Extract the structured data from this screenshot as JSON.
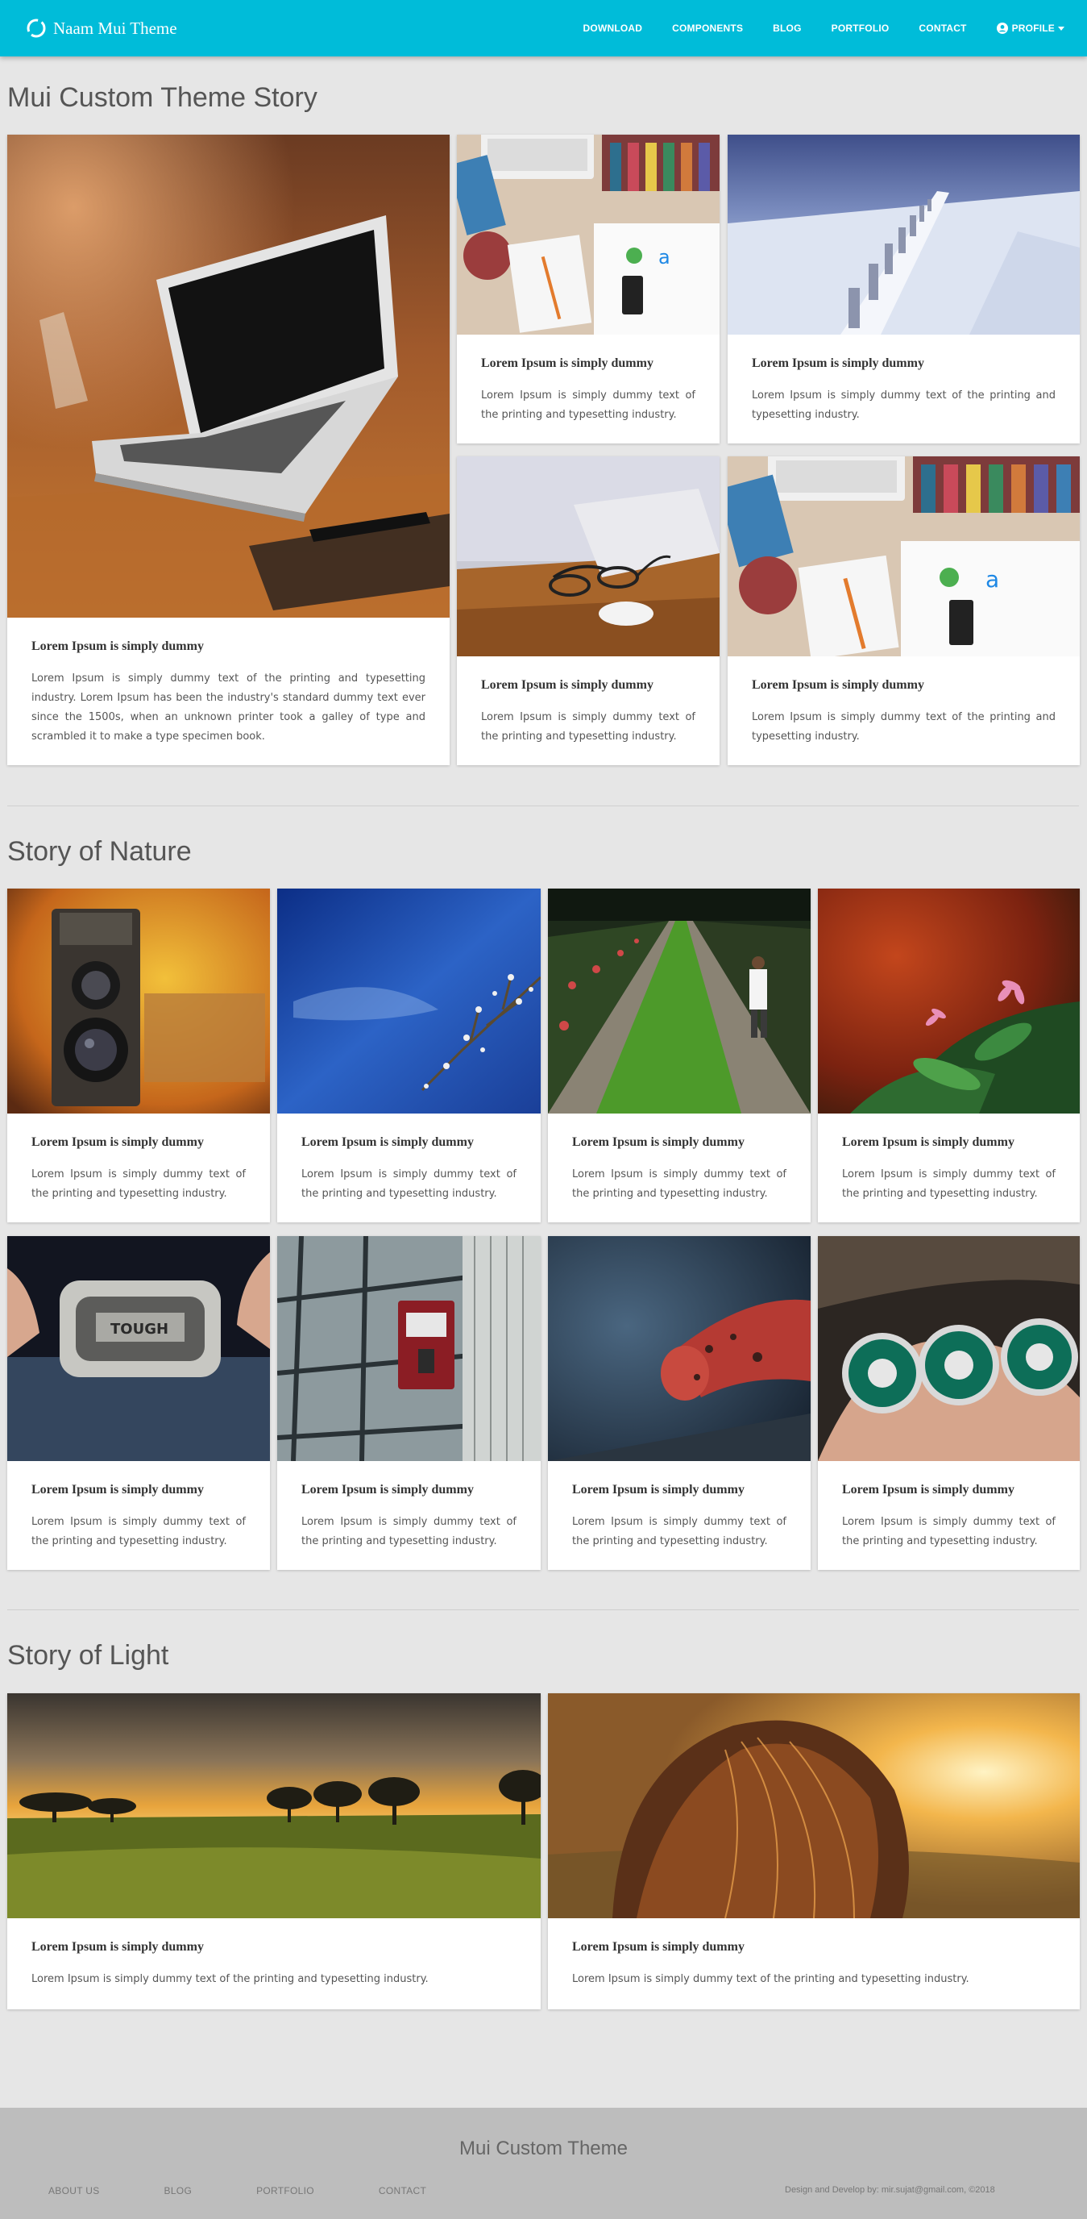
{
  "navbar": {
    "brand": "Naam Mui Theme",
    "items": [
      {
        "label": "DOWNLOAD"
      },
      {
        "label": "COMPONENTS"
      },
      {
        "label": "BLOG"
      },
      {
        "label": "PORTFOLIO"
      },
      {
        "label": "CONTACT"
      },
      {
        "label": "PROFILE",
        "icon": "user-circle-icon",
        "has_dropdown": true
      }
    ]
  },
  "sections": [
    {
      "title": "Mui Custom Theme Story",
      "cards": [
        {
          "image": "laptop-on-wooden-table-photo",
          "title": "Lorem Ipsum is simply dummy",
          "text": "Lorem Ipsum is simply dummy text of the printing and typesetting industry. Lorem Ipsum has been the industry's standard dummy text ever since the 1500s, when an unknown printer took a galley of type and scrambled it to make a type specimen book."
        },
        {
          "image": "desk-flatlay-photo",
          "title": "Lorem Ipsum is simply dummy",
          "text": "Lorem Ipsum is simply dummy text of the printing and typesetting industry."
        },
        {
          "image": "snowy-fence-landscape-photo",
          "title": "Lorem Ipsum is simply dummy",
          "text": "Lorem Ipsum is simply dummy text of the printing and typesetting industry."
        },
        {
          "image": "glasses-and-mouse-photo",
          "title": "Lorem Ipsum is simply dummy",
          "text": "Lorem Ipsum is simply dummy text of the printing and typesetting industry."
        },
        {
          "image": "desk-flatlay-photo",
          "title": "Lorem Ipsum is simply dummy",
          "text": "Lorem Ipsum is simply dummy text of the printing and typesetting industry."
        }
      ]
    },
    {
      "title": "Story of Nature",
      "cards": [
        {
          "image": "vintage-camera-photo",
          "title": "Lorem Ipsum is simply dummy",
          "text": "Lorem Ipsum is simply dummy text of the printing and typesetting industry."
        },
        {
          "image": "blue-sky-branches-photo",
          "title": "Lorem Ipsum is simply dummy",
          "text": "Lorem Ipsum is simply dummy text of the printing and typesetting industry."
        },
        {
          "image": "garden-path-photo",
          "title": "Lorem Ipsum is simply dummy",
          "text": "Lorem Ipsum is simply dummy text of the printing and typesetting industry."
        },
        {
          "image": "pink-flowers-photo",
          "title": "Lorem Ipsum is simply dummy",
          "text": "Lorem Ipsum is simply dummy text of the printing and typesetting industry."
        },
        {
          "image": "belt-buckle-photo",
          "title": "Lorem Ipsum is simply dummy",
          "text": "Lorem Ipsum is simply dummy text of the printing and typesetting industry."
        },
        {
          "image": "fire-alarm-photo",
          "title": "Lorem Ipsum is simply dummy",
          "text": "Lorem Ipsum is simply dummy text of the printing and typesetting industry."
        },
        {
          "image": "rusty-red-pipe-photo",
          "title": "Lorem Ipsum is simply dummy",
          "text": "Lorem Ipsum is simply dummy text of the printing and typesetting industry."
        },
        {
          "image": "coffee-badges-photo",
          "title": "Lorem Ipsum is simply dummy",
          "text": "Lorem Ipsum is simply dummy text of the printing and typesetting industry."
        }
      ]
    },
    {
      "title": "Story of Light",
      "cards": [
        {
          "image": "sunset-field-photo",
          "title": "Lorem Ipsum is simply dummy",
          "text": "Lorem Ipsum is simply dummy text of the printing and typesetting industry."
        },
        {
          "image": "girl-in-sunlight-photo",
          "title": "Lorem Ipsum is simply dummy",
          "text": "Lorem Ipsum is simply dummy text of the printing and typesetting industry."
        }
      ]
    }
  ],
  "footer": {
    "title": "Mui Custom Theme",
    "links": [
      {
        "label": "ABOUT US"
      },
      {
        "label": "BLOG"
      },
      {
        "label": "PORTFOLIO"
      },
      {
        "label": "CONTACT"
      }
    ],
    "credit": "Design and Develop by: mir.sujat@gmail.com, ©2018"
  },
  "colors": {
    "primary": "#00bcd9",
    "background": "#e6e6e6",
    "footer": "#bdbdbd"
  }
}
